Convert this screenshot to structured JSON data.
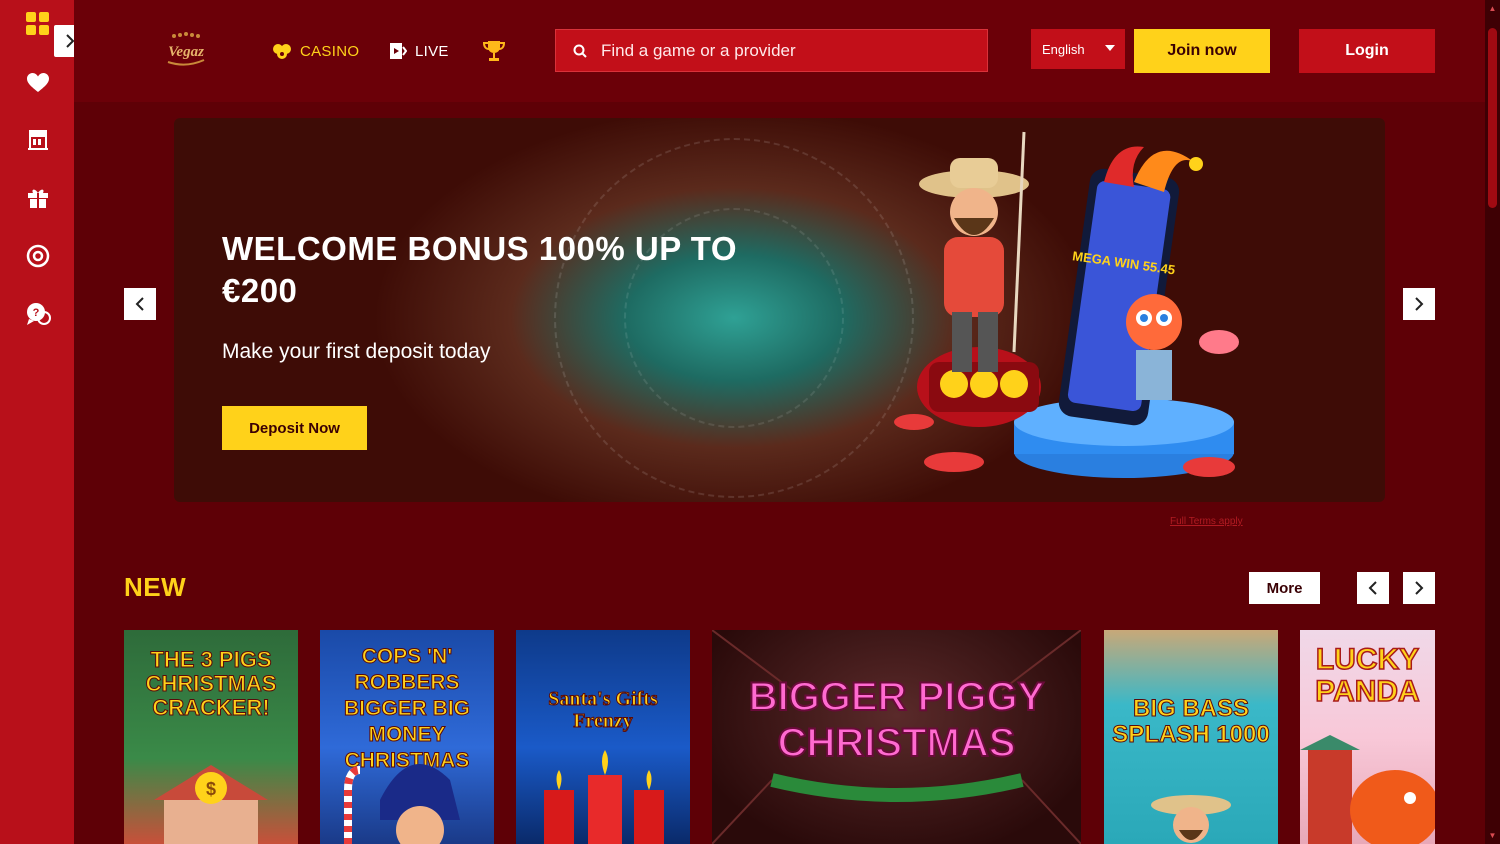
{
  "sidebar": {
    "items": [
      {
        "icon": "heart-icon"
      },
      {
        "icon": "casino-icon"
      },
      {
        "icon": "gift-icon"
      },
      {
        "icon": "support-icon"
      },
      {
        "icon": "chat-help-icon"
      }
    ]
  },
  "header": {
    "brand": "Vegaz",
    "nav": [
      {
        "label": "CASINO",
        "icon": "casino-chips-icon"
      },
      {
        "label": "LIVE",
        "icon": "live-icon"
      },
      {
        "label": "",
        "icon": "trophy-icon"
      }
    ],
    "search": {
      "placeholder": "Find a game or a provider"
    },
    "language": "English",
    "join_label": "Join now",
    "login_label": "Login"
  },
  "hero": {
    "title": "WELCOME BONUS 100% UP TO €200",
    "subtitle": "Make your first deposit today",
    "cta": "Deposit Now",
    "terms": "Full Terms apply",
    "art_text": "MEGA WIN 55.45"
  },
  "new_section": {
    "title": "NEW",
    "more_label": "More",
    "games": [
      {
        "title": "THE 3 PIGS CHRISTMAS CRACKER!"
      },
      {
        "title": "COPS 'N' ROBBERS BIGGER BIG MONEY CHRISTMAS"
      },
      {
        "title": "Santa's Gifts Frenzy"
      },
      {
        "title": "BIGGER PIGGY CHRISTMAS"
      },
      {
        "title": "BIG BASS SPLASH 1000"
      },
      {
        "title": "LUCKY PANDA"
      }
    ]
  },
  "colors": {
    "accent": "#ffd21a",
    "sidebar": "#b8101a",
    "header": "#6b0008",
    "background": "#5e0006"
  }
}
